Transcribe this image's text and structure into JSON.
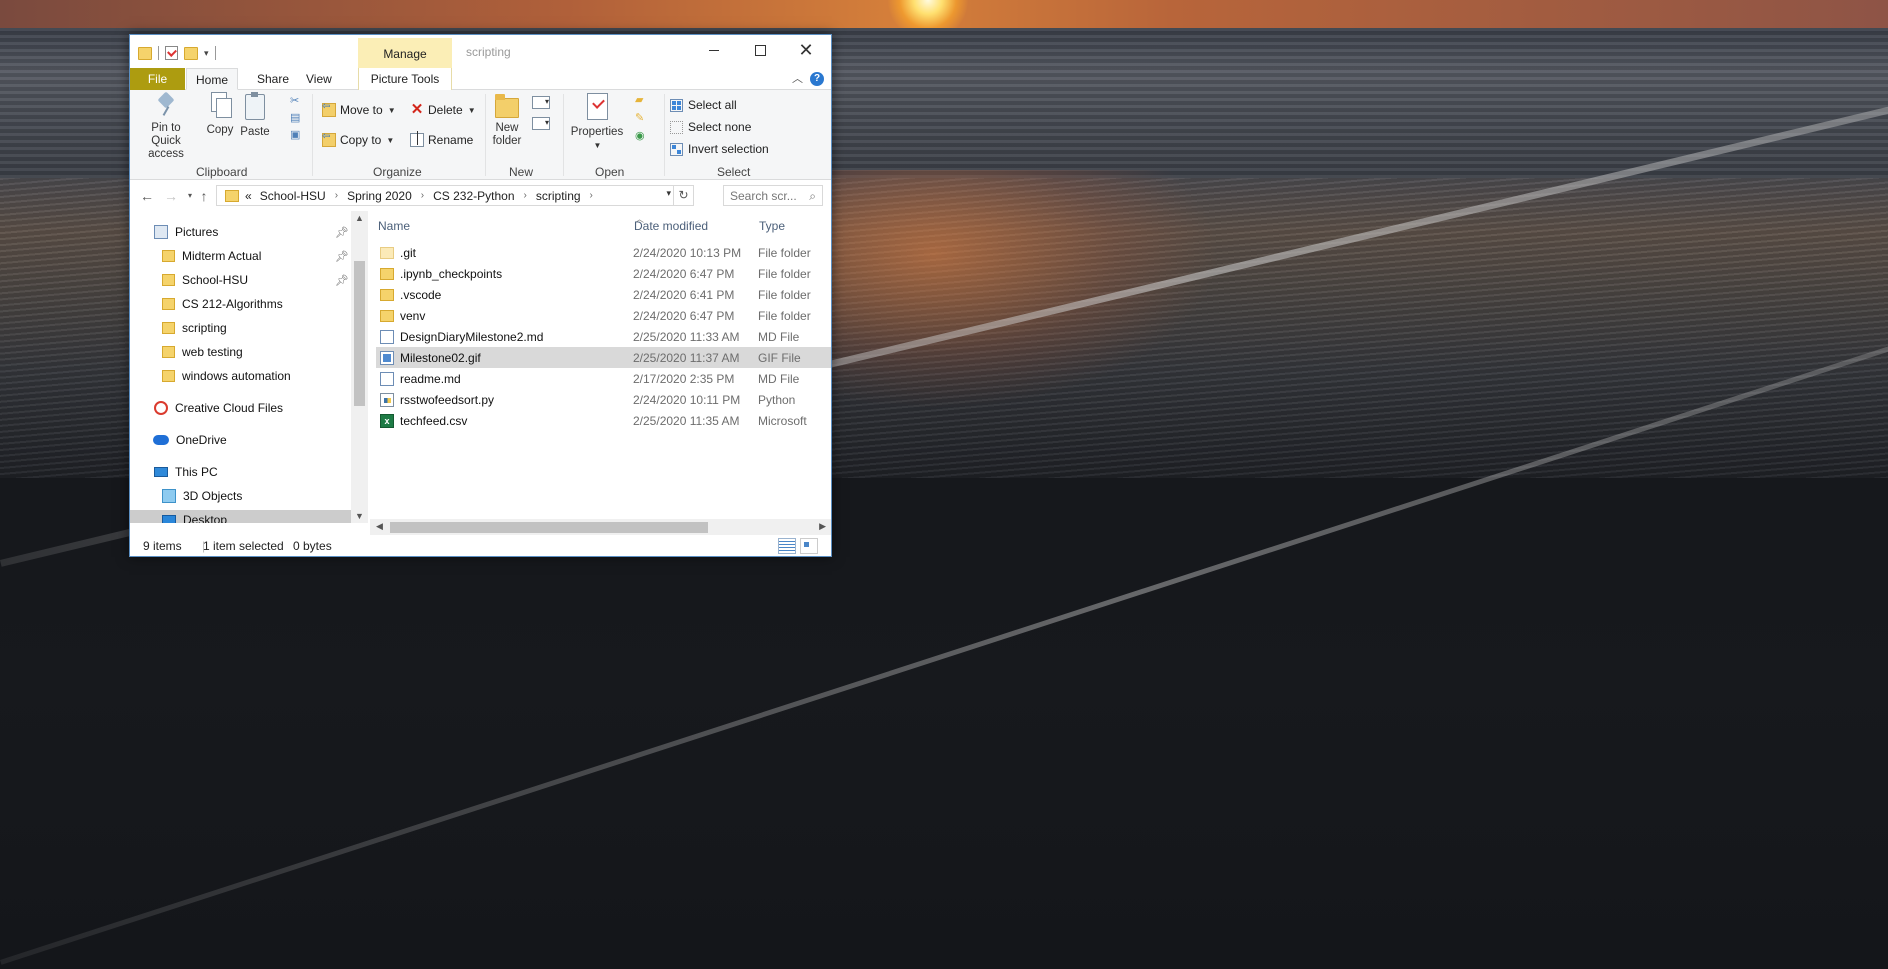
{
  "window": {
    "title": "scripting",
    "manage_tab": "Manage"
  },
  "tabs": {
    "file": "File",
    "home": "Home",
    "share": "Share",
    "view": "View",
    "picture_tools": "Picture Tools"
  },
  "ribbon": {
    "clipboard": {
      "label": "Clipboard",
      "pin_line1": "Pin to Quick",
      "pin_line2": "access",
      "copy": "Copy",
      "paste": "Paste"
    },
    "organize": {
      "label": "Organize",
      "move_to": "Move to",
      "copy_to": "Copy to",
      "delete": "Delete",
      "rename": "Rename"
    },
    "new": {
      "label": "New",
      "new_folder_line1": "New",
      "new_folder_line2": "folder"
    },
    "open": {
      "label": "Open",
      "properties": "Properties"
    },
    "select": {
      "label": "Select",
      "select_all": "Select all",
      "select_none": "Select none",
      "invert_selection": "Invert selection"
    }
  },
  "address": {
    "overflow": "«",
    "crumbs": [
      "School-HSU",
      "Spring 2020",
      "CS 232-Python",
      "scripting"
    ],
    "search_placeholder": "Search scr..."
  },
  "nav": {
    "items": [
      {
        "label": "Pictures",
        "icon": "pictures-icon",
        "pinned": true
      },
      {
        "label": "Midterm Actual",
        "icon": "folder-icon",
        "pinned": true
      },
      {
        "label": "School-HSU",
        "icon": "folder-icon",
        "pinned": true
      },
      {
        "label": "CS 212-Algorithms",
        "icon": "folder-icon",
        "pinned": false
      },
      {
        "label": "scripting",
        "icon": "folder-icon",
        "pinned": false
      },
      {
        "label": "web testing",
        "icon": "folder-icon",
        "pinned": false
      },
      {
        "label": "windows automation",
        "icon": "folder-icon",
        "pinned": false
      },
      {
        "label": "Creative Cloud Files",
        "icon": "creative-cloud-icon",
        "pinned": false
      },
      {
        "label": "OneDrive",
        "icon": "onedrive-icon",
        "pinned": false
      },
      {
        "label": "This PC",
        "icon": "this-pc-icon",
        "pinned": false
      },
      {
        "label": "3D Objects",
        "icon": "3d-objects-icon",
        "pinned": false
      },
      {
        "label": "Desktop",
        "icon": "desktop-icon",
        "pinned": false,
        "selected": true
      }
    ]
  },
  "columns": {
    "name": "Name",
    "date": "Date modified",
    "type": "Type"
  },
  "files": [
    {
      "name": ".git",
      "date": "2/24/2020 10:13 PM",
      "type": "File folder",
      "icon": "hidden-folder-icon"
    },
    {
      "name": ".ipynb_checkpoints",
      "date": "2/24/2020 6:47 PM",
      "type": "File folder",
      "icon": "folder-icon"
    },
    {
      "name": ".vscode",
      "date": "2/24/2020 6:41 PM",
      "type": "File folder",
      "icon": "folder-icon"
    },
    {
      "name": "venv",
      "date": "2/24/2020 6:47 PM",
      "type": "File folder",
      "icon": "folder-icon"
    },
    {
      "name": "DesignDiaryMilestone2.md",
      "date": "2/25/2020 11:33 AM",
      "type": "MD File",
      "icon": "markdown-file-icon"
    },
    {
      "name": "Milestone02.gif",
      "date": "2/25/2020 11:37 AM",
      "type": "GIF File",
      "icon": "gif-file-icon",
      "selected": true
    },
    {
      "name": "readme.md",
      "date": "2/17/2020 2:35 PM",
      "type": "MD File",
      "icon": "markdown-file-icon"
    },
    {
      "name": "rsstwofeedsort.py",
      "date": "2/24/2020 10:11 PM",
      "type": "Python",
      "icon": "python-file-icon"
    },
    {
      "name": "techfeed.csv",
      "date": "2/25/2020 11:35 AM",
      "type": "Microsoft",
      "icon": "excel-csv-icon"
    }
  ],
  "status": {
    "item_count": "9 items",
    "selection": "1 item selected",
    "size": "0 bytes"
  }
}
